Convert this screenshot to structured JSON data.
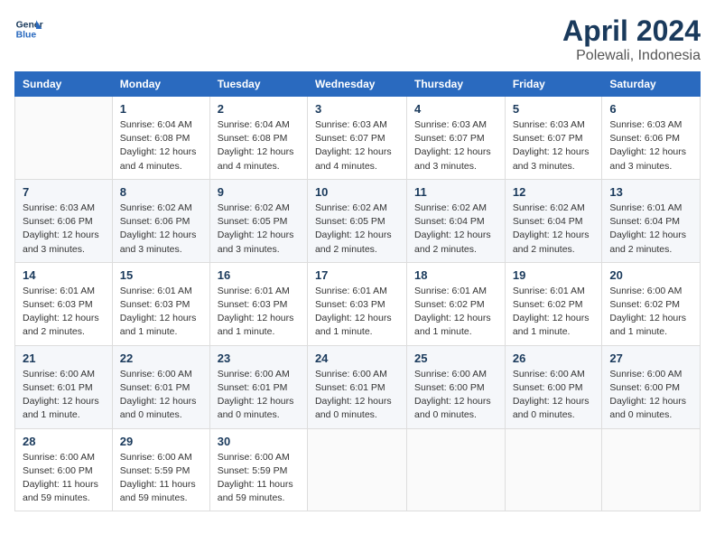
{
  "header": {
    "logo_line1": "General",
    "logo_line2": "Blue",
    "month": "April 2024",
    "location": "Polewali, Indonesia"
  },
  "weekdays": [
    "Sunday",
    "Monday",
    "Tuesday",
    "Wednesday",
    "Thursday",
    "Friday",
    "Saturday"
  ],
  "weeks": [
    [
      {
        "day": "",
        "info": ""
      },
      {
        "day": "1",
        "info": "Sunrise: 6:04 AM\nSunset: 6:08 PM\nDaylight: 12 hours\nand 4 minutes."
      },
      {
        "day": "2",
        "info": "Sunrise: 6:04 AM\nSunset: 6:08 PM\nDaylight: 12 hours\nand 4 minutes."
      },
      {
        "day": "3",
        "info": "Sunrise: 6:03 AM\nSunset: 6:07 PM\nDaylight: 12 hours\nand 4 minutes."
      },
      {
        "day": "4",
        "info": "Sunrise: 6:03 AM\nSunset: 6:07 PM\nDaylight: 12 hours\nand 3 minutes."
      },
      {
        "day": "5",
        "info": "Sunrise: 6:03 AM\nSunset: 6:07 PM\nDaylight: 12 hours\nand 3 minutes."
      },
      {
        "day": "6",
        "info": "Sunrise: 6:03 AM\nSunset: 6:06 PM\nDaylight: 12 hours\nand 3 minutes."
      }
    ],
    [
      {
        "day": "7",
        "info": "Sunrise: 6:03 AM\nSunset: 6:06 PM\nDaylight: 12 hours\nand 3 minutes."
      },
      {
        "day": "8",
        "info": "Sunrise: 6:02 AM\nSunset: 6:06 PM\nDaylight: 12 hours\nand 3 minutes."
      },
      {
        "day": "9",
        "info": "Sunrise: 6:02 AM\nSunset: 6:05 PM\nDaylight: 12 hours\nand 3 minutes."
      },
      {
        "day": "10",
        "info": "Sunrise: 6:02 AM\nSunset: 6:05 PM\nDaylight: 12 hours\nand 2 minutes."
      },
      {
        "day": "11",
        "info": "Sunrise: 6:02 AM\nSunset: 6:04 PM\nDaylight: 12 hours\nand 2 minutes."
      },
      {
        "day": "12",
        "info": "Sunrise: 6:02 AM\nSunset: 6:04 PM\nDaylight: 12 hours\nand 2 minutes."
      },
      {
        "day": "13",
        "info": "Sunrise: 6:01 AM\nSunset: 6:04 PM\nDaylight: 12 hours\nand 2 minutes."
      }
    ],
    [
      {
        "day": "14",
        "info": "Sunrise: 6:01 AM\nSunset: 6:03 PM\nDaylight: 12 hours\nand 2 minutes."
      },
      {
        "day": "15",
        "info": "Sunrise: 6:01 AM\nSunset: 6:03 PM\nDaylight: 12 hours\nand 1 minute."
      },
      {
        "day": "16",
        "info": "Sunrise: 6:01 AM\nSunset: 6:03 PM\nDaylight: 12 hours\nand 1 minute."
      },
      {
        "day": "17",
        "info": "Sunrise: 6:01 AM\nSunset: 6:03 PM\nDaylight: 12 hours\nand 1 minute."
      },
      {
        "day": "18",
        "info": "Sunrise: 6:01 AM\nSunset: 6:02 PM\nDaylight: 12 hours\nand 1 minute."
      },
      {
        "day": "19",
        "info": "Sunrise: 6:01 AM\nSunset: 6:02 PM\nDaylight: 12 hours\nand 1 minute."
      },
      {
        "day": "20",
        "info": "Sunrise: 6:00 AM\nSunset: 6:02 PM\nDaylight: 12 hours\nand 1 minute."
      }
    ],
    [
      {
        "day": "21",
        "info": "Sunrise: 6:00 AM\nSunset: 6:01 PM\nDaylight: 12 hours\nand 1 minute."
      },
      {
        "day": "22",
        "info": "Sunrise: 6:00 AM\nSunset: 6:01 PM\nDaylight: 12 hours\nand 0 minutes."
      },
      {
        "day": "23",
        "info": "Sunrise: 6:00 AM\nSunset: 6:01 PM\nDaylight: 12 hours\nand 0 minutes."
      },
      {
        "day": "24",
        "info": "Sunrise: 6:00 AM\nSunset: 6:01 PM\nDaylight: 12 hours\nand 0 minutes."
      },
      {
        "day": "25",
        "info": "Sunrise: 6:00 AM\nSunset: 6:00 PM\nDaylight: 12 hours\nand 0 minutes."
      },
      {
        "day": "26",
        "info": "Sunrise: 6:00 AM\nSunset: 6:00 PM\nDaylight: 12 hours\nand 0 minutes."
      },
      {
        "day": "27",
        "info": "Sunrise: 6:00 AM\nSunset: 6:00 PM\nDaylight: 12 hours\nand 0 minutes."
      }
    ],
    [
      {
        "day": "28",
        "info": "Sunrise: 6:00 AM\nSunset: 6:00 PM\nDaylight: 11 hours\nand 59 minutes."
      },
      {
        "day": "29",
        "info": "Sunrise: 6:00 AM\nSunset: 5:59 PM\nDaylight: 11 hours\nand 59 minutes."
      },
      {
        "day": "30",
        "info": "Sunrise: 6:00 AM\nSunset: 5:59 PM\nDaylight: 11 hours\nand 59 minutes."
      },
      {
        "day": "",
        "info": ""
      },
      {
        "day": "",
        "info": ""
      },
      {
        "day": "",
        "info": ""
      },
      {
        "day": "",
        "info": ""
      }
    ]
  ]
}
